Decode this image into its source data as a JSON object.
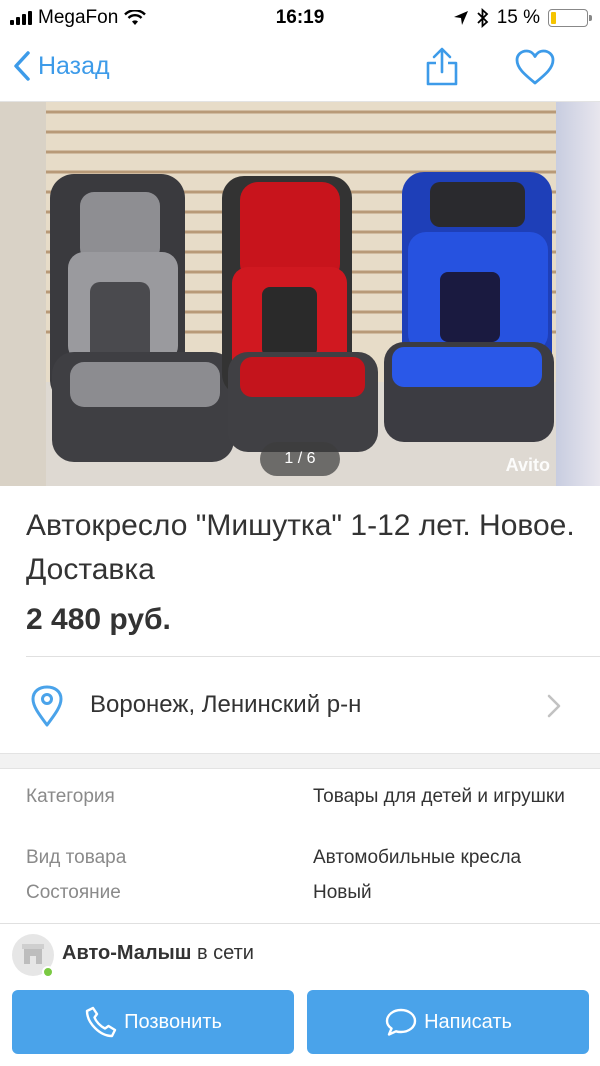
{
  "status_bar": {
    "carrier": "MegaFon",
    "time": "16:19",
    "battery_percent": "15 %",
    "battery_level": 0.15,
    "icons": [
      "signal-icon",
      "wifi-icon",
      "location-arrow-icon",
      "bluetooth-icon",
      "battery-icon"
    ]
  },
  "nav": {
    "back_label": "Назад",
    "icons": [
      "chevron-left-icon",
      "share-icon",
      "heart-icon"
    ]
  },
  "gallery": {
    "counter": "1 / 6",
    "watermark": "Avito",
    "current_index": 1,
    "total": 6
  },
  "listing": {
    "title": "Автокресло \"Мишутка\" 1-12 лет. Новое. Доставка",
    "price": "2 480 руб."
  },
  "location": {
    "text": "Воронеж, Ленинский р-н",
    "icons": [
      "map-pin-icon",
      "chevron-right-icon"
    ]
  },
  "details": [
    {
      "key": "Категория",
      "value": "Товары для детей и игрушки"
    },
    {
      "key": "Вид товара",
      "value": "Автомобильные кресла"
    },
    {
      "key": "Состояние",
      "value": "Новый"
    }
  ],
  "seller": {
    "name": "Авто-Малыш",
    "status": "в сети"
  },
  "actions": {
    "call_label": "Позвонить",
    "write_label": "Написать"
  },
  "colors": {
    "accent": "#4aa3ea",
    "link": "#3d9be9",
    "online": "#7ac943",
    "battery": "#f5c400"
  }
}
